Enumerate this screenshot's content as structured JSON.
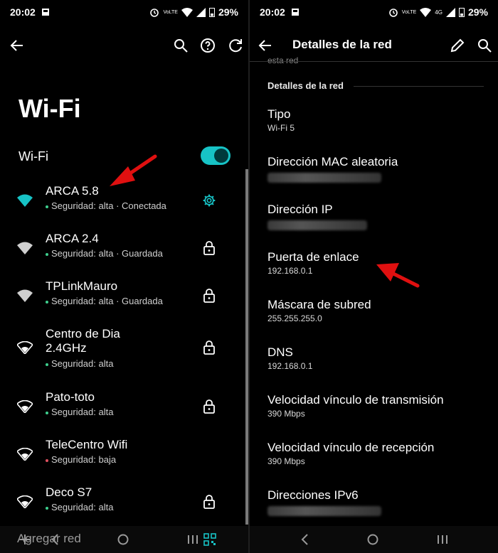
{
  "status": {
    "time": "20:02",
    "volte": "VoLTE",
    "four_g": "4G",
    "battery": "29%"
  },
  "left": {
    "title": "Wi-Fi",
    "toggle_label": "Wi-Fi",
    "networks": [
      {
        "name": "ARCA 5.8",
        "status": "Seguridad: alta · Conectada"
      },
      {
        "name": "ARCA 2.4",
        "status": "Seguridad: alta · Guardada"
      },
      {
        "name": "TPLinkMauro",
        "status": "Seguridad: alta · Guardada"
      },
      {
        "name": "Centro de Dia 2.4GHz",
        "status": "Seguridad: alta"
      },
      {
        "name": "Pato-toto",
        "status": "Seguridad: alta"
      },
      {
        "name": "TeleCentro Wifi",
        "status": "Seguridad: baja"
      },
      {
        "name": "Deco S7",
        "status": "Seguridad: alta"
      }
    ],
    "add_network": "Agregar red"
  },
  "right": {
    "title": "Detalles de la red",
    "cut_text": "esta red",
    "section": "Detalles de la red",
    "details": [
      {
        "label": "Tipo",
        "value": "Wi-Fi 5"
      },
      {
        "label": "Dirección MAC aleatoria",
        "value": ""
      },
      {
        "label": "Dirección IP",
        "value": ""
      },
      {
        "label": "Puerta de enlace",
        "value": "192.168.0.1"
      },
      {
        "label": "Máscara de subred",
        "value": "255.255.255.0"
      },
      {
        "label": "DNS",
        "value": "192.168.0.1"
      },
      {
        "label": "Velocidad vínculo de transmisión",
        "value": "390 Mbps"
      },
      {
        "label": "Velocidad vínculo de recepción",
        "value": "390 Mbps"
      },
      {
        "label": "Direcciones IPv6",
        "value": ""
      }
    ]
  },
  "colors": {
    "accent": "#17c3c6",
    "arrow": "#e01010",
    "green_dot": "#3ecf8e",
    "red_dot": "#e05060"
  },
  "icons": [
    "back-arrow-icon",
    "search-icon",
    "help-icon",
    "rotate-icon",
    "wifi-icon",
    "settings-gear-icon",
    "lock-icon",
    "plus-icon",
    "qr-code-icon",
    "edit-pencil-icon"
  ]
}
